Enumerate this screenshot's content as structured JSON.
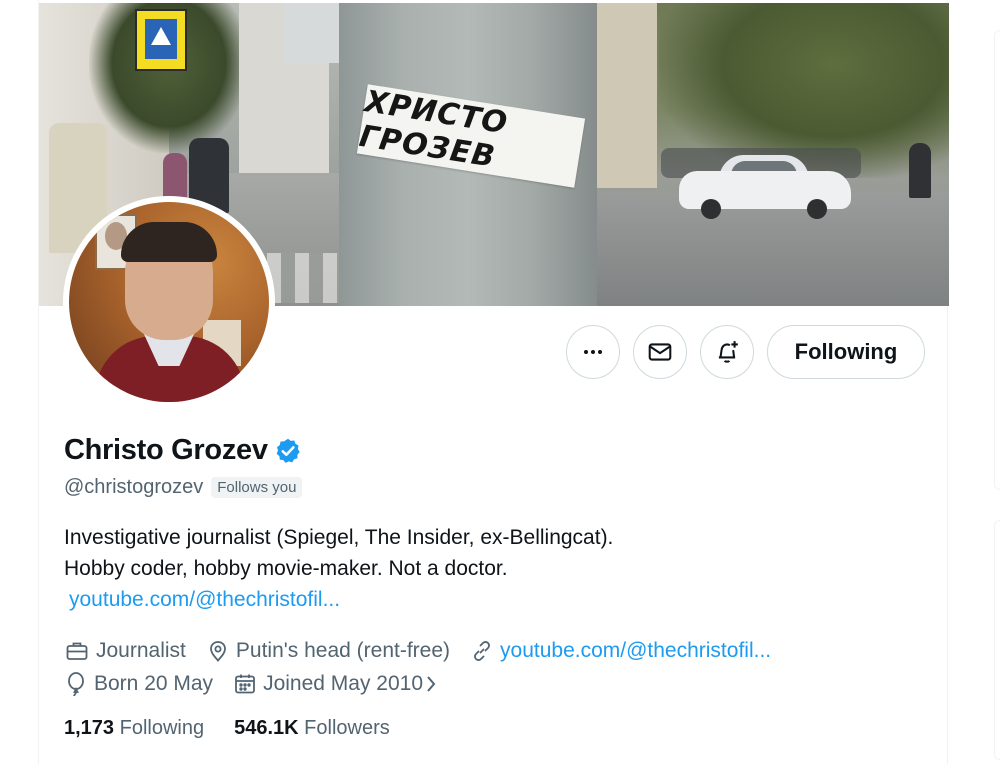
{
  "banner": {
    "sticker_text": "ХРИСТО ГРОЗЕВ"
  },
  "actions": {
    "more_icon": "more-icon",
    "message_icon": "envelope-icon",
    "notify_icon": "bell-plus-icon",
    "follow_label": "Following"
  },
  "profile": {
    "display_name": "Christo Grozev",
    "verified": true,
    "handle": "@christogrozev",
    "follows_you": "Follows you",
    "bio_line1": "Investigative journalist (Spiegel, The Insider, ex-Bellingcat).",
    "bio_line2": "Hobby coder, hobby movie-maker. Not a doctor.",
    "bio_link": "youtube.com/@thechristofil...",
    "profession": "Journalist",
    "location": "Putin's head (rent-free)",
    "website": "youtube.com/@thechristofil...",
    "birthday": "Born 20 May",
    "joined": "Joined May 2010",
    "following_count": "1,173",
    "following_label": "Following",
    "followers_count": "546.1K",
    "followers_label": "Followers"
  },
  "colors": {
    "accent": "#1d9bf0",
    "secondary_text": "#536471",
    "primary_text": "#0f1419",
    "border": "#cfd9de"
  }
}
